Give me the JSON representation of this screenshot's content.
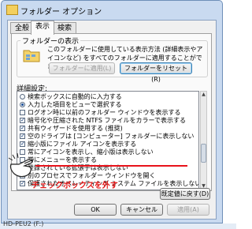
{
  "window": {
    "title": "フォルダー オプション"
  },
  "tabs": [
    {
      "label": "全般"
    },
    {
      "label": "表示"
    },
    {
      "label": "検索"
    }
  ],
  "folder_view": {
    "group_title": "フォルダーの表示",
    "description": "このフォルダーに使用している表示方法 (詳細表示やアイコンなど) をすべてのフォルダーに適用することができます。",
    "apply_button": "フォルダーに適用(L)",
    "reset_button": "フォルダーをリセット(R)"
  },
  "advanced": {
    "title": "詳細設定:",
    "items": [
      {
        "label": "検索ボックスに自動的に入力する",
        "type": "radio",
        "checked": false
      },
      {
        "label": "入力した項目をビューで選択する",
        "type": "radio",
        "checked": true
      },
      {
        "label": "ログオン時に以前のフォルダー ウィンドウを表示する",
        "type": "checkbox",
        "checked": false
      },
      {
        "label": "暗号化や圧縮された NTFS ファイルをカラーで表示する",
        "type": "checkbox",
        "checked": true
      },
      {
        "label": "共有ウィザードを使用する (推奨)",
        "type": "checkbox",
        "checked": true
      },
      {
        "label": "空のドライブは [コンピューター] フォルダーに表示しない",
        "type": "checkbox",
        "checked": true
      },
      {
        "label": "縮小版にファイル アイコンを表示する",
        "type": "checkbox",
        "checked": true
      },
      {
        "label": "常にアイコンを表示し、縮小版は表示しない",
        "type": "checkbox",
        "checked": false
      },
      {
        "label": "常にメニューを表示する",
        "type": "checkbox",
        "checked": false
      },
      {
        "label": "登録されている拡張子は表示しない",
        "type": "checkbox",
        "checked": false
      },
      {
        "label": "別のプロセスでフォルダー ウィンドウを開く",
        "type": "checkbox",
        "checked": false
      },
      {
        "label": "保護されたオペレーティング システム ファイルを表示しない (推奨)",
        "type": "checkbox",
        "checked": true
      }
    ]
  },
  "buttons": {
    "restore_defaults": "既定値に戻す(D)",
    "ok": "OK",
    "cancel": "キャンセル",
    "apply": "適用(A)"
  },
  "annotation": {
    "text": "チェックボックスを外す",
    "color": "#e51a1a"
  },
  "background": {
    "status_text": "HD-PEU2 (F:)"
  }
}
